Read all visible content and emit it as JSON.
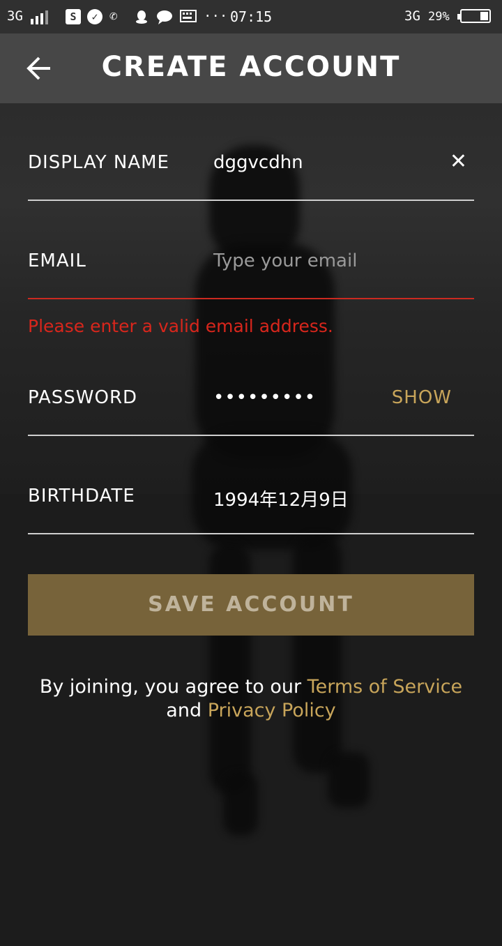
{
  "status_bar": {
    "network_left": "3G",
    "time": "07:15",
    "network_right": "3G",
    "battery": "29%",
    "icons": [
      "signal-icon",
      "s-app-icon",
      "check-circle-icon",
      "phone-icon",
      "qq-icon",
      "chat-icon",
      "keyboard-icon",
      "more-dots-icon"
    ]
  },
  "app_bar": {
    "title": "CREATE ACCOUNT",
    "back_icon": "back-arrow-icon"
  },
  "form": {
    "display_name": {
      "label": "DISPLAY NAME",
      "value": "dggvcdhn",
      "clear_icon": "close-icon"
    },
    "email": {
      "label": "EMAIL",
      "value": "",
      "placeholder": "Type your email",
      "error": "Please enter a valid email address."
    },
    "password": {
      "label": "PASSWORD",
      "value": "•••••••••",
      "toggle": "SHOW"
    },
    "birthdate": {
      "label": "BIRTHDATE",
      "value": "1994年12月9日"
    },
    "save_button": "SAVE ACCOUNT"
  },
  "terms": {
    "prefix": "By joining, you agree to our",
    "terms_link": "Terms of Service",
    "and": "and",
    "privacy_link": "Privacy Policy"
  },
  "colors": {
    "accent": "#c8a55a",
    "error": "#d8261c",
    "button": "#77633a",
    "appbar": "#474747"
  }
}
